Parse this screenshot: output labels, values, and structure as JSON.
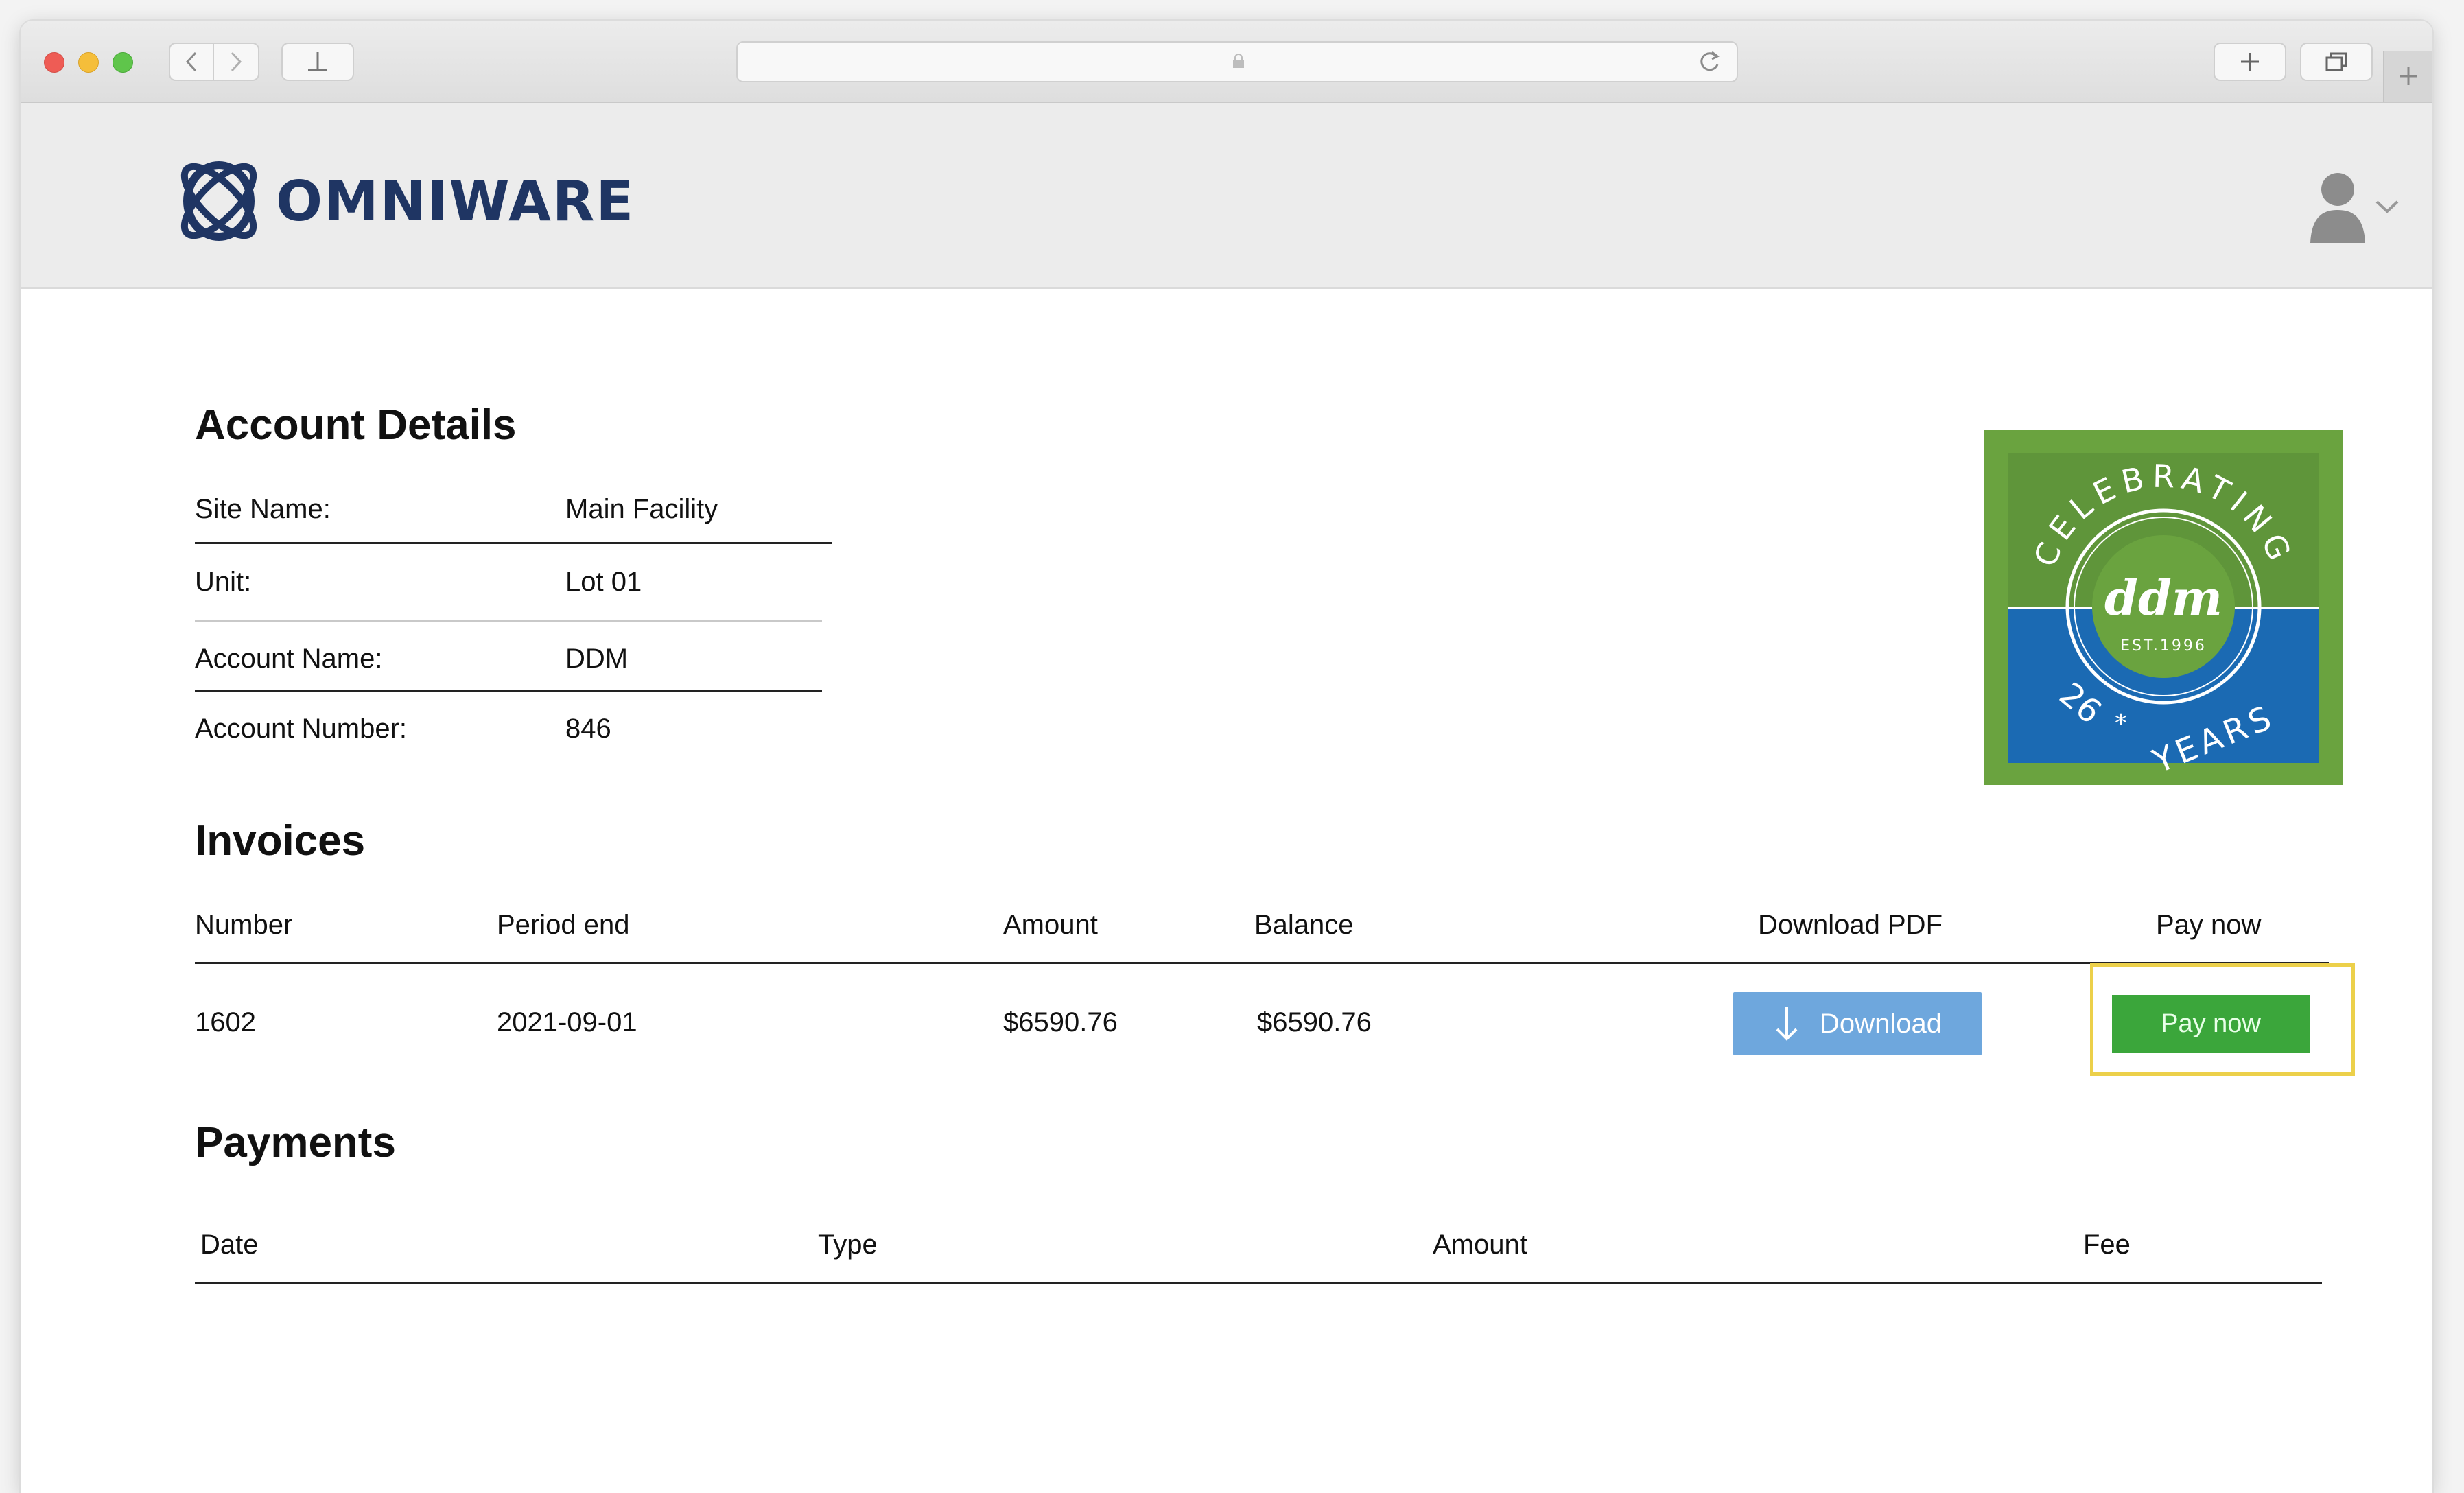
{
  "browser": {
    "back_icon": "chevron-left-icon",
    "forward_icon": "chevron-right-icon",
    "share_icon": "share-icon",
    "reload_icon": "reload-icon",
    "new_tab_icon": "plus-icon",
    "tabs_icon": "tabs-icon"
  },
  "header": {
    "logo_text": "OMNIWARE",
    "user_icon": "user-icon",
    "dropdown_icon": "chevron-down-icon"
  },
  "account": {
    "title": "Account Details",
    "rows": [
      {
        "label": "Site Name:",
        "value": "Main Facility"
      },
      {
        "label": "Unit:",
        "value": "Lot 01"
      },
      {
        "label": "Account Name:",
        "value": "DDM"
      },
      {
        "label": "Account Number:",
        "value": "846"
      }
    ]
  },
  "badge": {
    "top_text": "CELEBRATING",
    "center_text": "ddm",
    "est_text": "EST.1996",
    "bottom_number": "26",
    "bottom_text": "YEARS",
    "colors": {
      "outer": "#6aa33f",
      "top": "#5f953a",
      "bottom": "#1b6ab3"
    }
  },
  "invoices": {
    "title": "Invoices",
    "columns": [
      "Number",
      "Period end",
      "Amount",
      "Balance",
      "Download PDF",
      "Pay now"
    ],
    "rows": [
      {
        "number": "1602",
        "period_end": "2021-09-01",
        "amount": "$6590.76",
        "balance": "$6590.76",
        "download_label": "Download",
        "pay_label": "Pay now"
      }
    ]
  },
  "payments": {
    "title": "Payments",
    "columns": [
      "Date",
      "Type",
      "Amount",
      "Fee"
    ],
    "rows": []
  }
}
